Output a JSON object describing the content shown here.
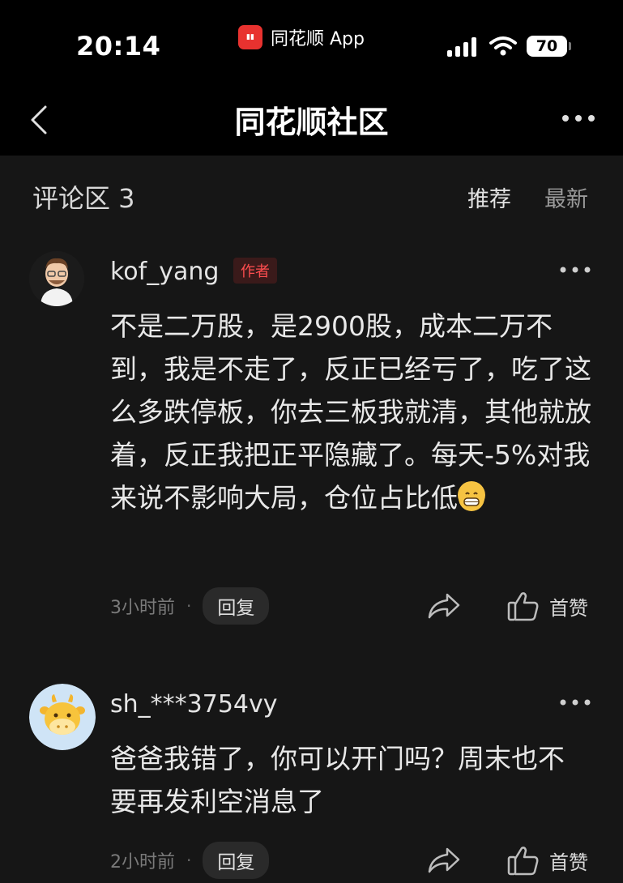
{
  "status_bar": {
    "time": "20:14",
    "app_name": "同花顺 App",
    "battery": "70"
  },
  "nav": {
    "title": "同花顺社区"
  },
  "section": {
    "title": "评论区 3",
    "sort_recommended": "推荐",
    "sort_latest": "最新"
  },
  "comments": [
    {
      "username": "kof_yang",
      "badge": "作者",
      "text": "不是二万股，是2900股，成本二万不到，我是不走了，反正已经亏了，吃了这么多跌停板，你去三板我就清，其他就放着，反正我把正平隐藏了。每天-5%对我来说不影响大局，仓位占比低",
      "time": "3小时前",
      "reply": "回复",
      "like": "首赞"
    },
    {
      "username": "sh_***3754vy",
      "text": "爸爸我错了，你可以开门吗？周末也不要再发利空消息了",
      "time": "2小时前",
      "reply": "回复",
      "like": "首赞"
    }
  ],
  "colors": {
    "accent_red": "#e8322f",
    "author_badge": "#ff4d4f",
    "background": "#161616"
  }
}
